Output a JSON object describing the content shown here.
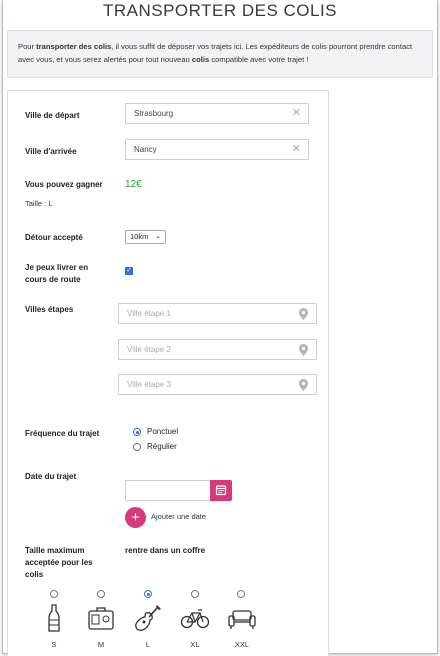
{
  "page": {
    "title": "TRANSPORTER DES COLIS"
  },
  "info": {
    "part1": "Pour ",
    "bold1": "transporter des colis",
    "part2": ", il vous suffit de déposer vos trajets ici. Les expéditeurs de colis pourront prendre contact avec vous, et vous serez alertés pour tout nouveau ",
    "bold2": "colis",
    "part3": " compatible avec votre trajet !"
  },
  "form": {
    "departure_label": "Ville de départ",
    "departure_value": "Strasbourg",
    "arrival_label": "Ville d'arrivée",
    "arrival_value": "Nancy",
    "earn_label": "Vous pouvez gagner",
    "earn_value": "12€",
    "size_info": "Taille : L",
    "detour_label": "Détour accepté",
    "detour_value": "10km",
    "en_route_label_1": "Je peux livrer en",
    "en_route_label_2": "cours de route",
    "stops_label": "Villes étapes",
    "stop1_placeholder": "Ville étape 1",
    "stop2_placeholder": "Ville étape 2",
    "stop3_placeholder": "Ville étape 3",
    "frequency_label": "Fréquence du trajet",
    "frequency_options": [
      "Ponctuel",
      "Régulier"
    ],
    "frequency_selected": "Ponctuel",
    "date_label": "Date du trajet",
    "add_date_label": "Ajouter une date",
    "max_size_label_1": "Taille maximum",
    "max_size_label_2": "acceptée pour les",
    "max_size_label_3": "colis",
    "max_size_hint": "rentre dans un coffre",
    "sizes": [
      {
        "label": "S",
        "icon": "bottle-icon"
      },
      {
        "label": "M",
        "icon": "suitcase-icon"
      },
      {
        "label": "L",
        "icon": "guitar-icon"
      },
      {
        "label": "XL",
        "icon": "bicycle-icon"
      },
      {
        "label": "XXL",
        "icon": "sofa-icon"
      }
    ],
    "size_selected": "L"
  },
  "colors": {
    "accent": "#d63a7a",
    "earn": "#2e9e3e",
    "radio": "#2e6fd9"
  }
}
